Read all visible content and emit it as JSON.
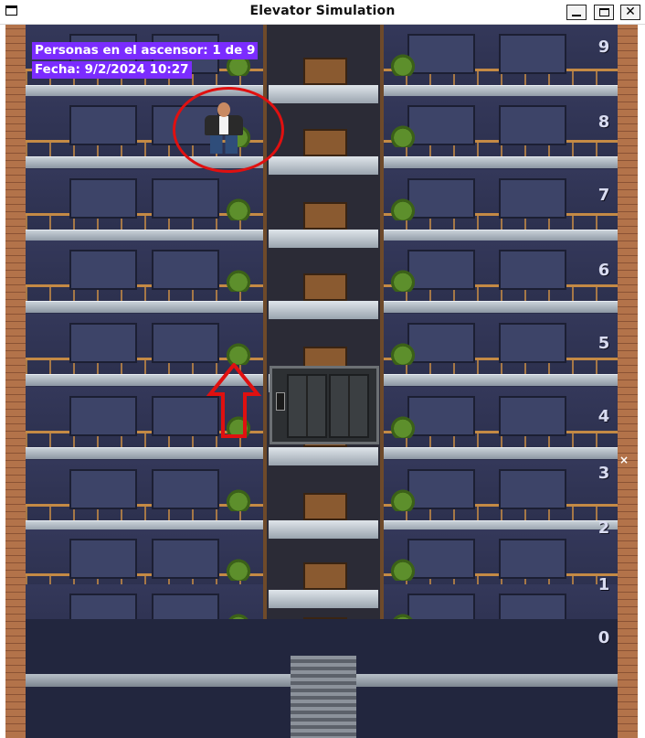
{
  "window": {
    "title": "Elevator Simulation",
    "controls": [
      "minimize",
      "maximize",
      "close"
    ]
  },
  "status": {
    "people_in_elevator": "Personas en el ascensor: 1 de 9",
    "date": "Fecha: 9/2/2024 10:27"
  },
  "building": {
    "floors": [
      "9",
      "8",
      "7",
      "6",
      "5",
      "4",
      "3",
      "2",
      "1",
      "0"
    ],
    "shaft_marker": "×"
  },
  "colors": {
    "info_background": "#7b2cff",
    "annotation": "#e01010",
    "floor_label": "#d9dcf0"
  },
  "icons": {
    "window": "window-icon",
    "person": "person-icon",
    "elevator": "elevator-icon",
    "arrow": "up-arrow-icon"
  }
}
